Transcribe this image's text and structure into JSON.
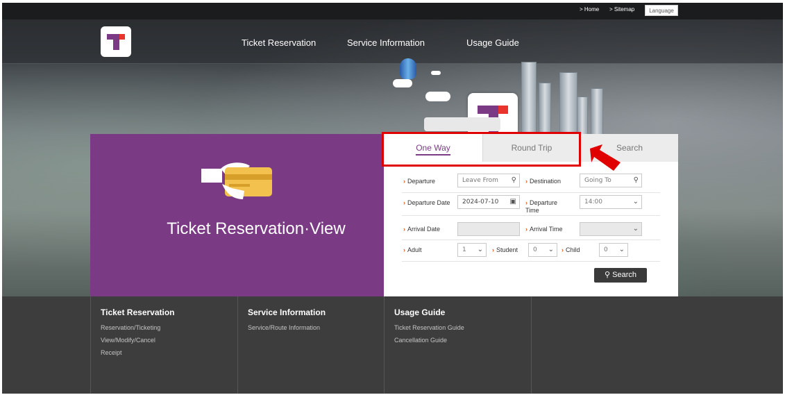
{
  "utility": {
    "home": "> Home",
    "sitemap": "> Sitemap",
    "language": "Language"
  },
  "nav": {
    "items": [
      "Ticket Reservation",
      "Service Information",
      "Usage Guide"
    ]
  },
  "hero": {
    "title": "Ticket Reservation·View"
  },
  "tabs": {
    "one_way": "One Way",
    "round_trip": "Round Trip",
    "search": "Search"
  },
  "form": {
    "departure_label": "Departure",
    "departure_placeholder": "Leave From",
    "destination_label": "Destination",
    "destination_placeholder": "Going To",
    "departure_date_label": "Departure Date",
    "departure_date_value": "2024-07-10",
    "departure_time_label": "Departure Time",
    "departure_time_value": "14:00",
    "arrival_date_label": "Arrival Date",
    "arrival_time_label": "Arrival Time",
    "adult_label": "Adult",
    "adult_value": "1",
    "student_label": "Student",
    "student_value": "0",
    "child_label": "Child",
    "child_value": "0",
    "search_button": "Search"
  },
  "footer": {
    "columns": [
      {
        "heading": "Ticket Reservation",
        "links": [
          "Reservation/Ticketing",
          "View/Modify/Cancel",
          "Receipt"
        ]
      },
      {
        "heading": "Service Information",
        "links": [
          "Service/Route Information"
        ]
      },
      {
        "heading": "Usage Guide",
        "links": [
          "Ticket Reservation Guide",
          "Cancellation Guide"
        ]
      }
    ]
  },
  "colors": {
    "brand_purple": "#7a3a84",
    "highlight_red": "#e00000",
    "footer_bg": "#3d3d3d"
  },
  "icons": [
    "logo-icon",
    "search-icon",
    "calendar-icon",
    "chevron-down-icon",
    "card-hand-icon",
    "red-arrow-icon"
  ]
}
